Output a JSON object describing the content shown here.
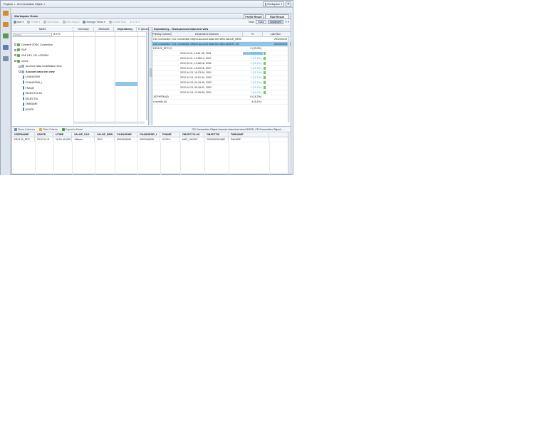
{
  "breadcrumb": {
    "root": "Projects",
    "item": "CD Connection Object"
  },
  "workspace_btn": "Workspace",
  "workspace": {
    "title": "Workspace Home",
    "profile_result": "Profile Result",
    "rule_result": "Rule Result"
  },
  "toolbar": {
    "add": "Add",
    "profile": "Profile",
    "view_data": "View Data",
    "view_import": "View Import",
    "manage_views": "Manage Views",
    "create_rule": "Create Rule",
    "view_label": "View:",
    "basic": "Basic",
    "advanced": "Advanced"
  },
  "left_panel": {
    "headers": {
      "tables": "Tables",
      "summary": "Summary",
      "attributes": "Attributes",
      "dependency": "Dependency",
      "r": "R",
      "advanced": "Advanc"
    },
    "search_placeholder": "Search",
    "tree": [
      {
        "label": "Overseft ODBC Connection",
        "indent": 0
      },
      {
        "label": "SAP",
        "indent": 0
      },
      {
        "label": "SAP DE1 120 LASDEM",
        "indent": 0
      },
      {
        "label": "Views",
        "indent": 0
      },
      {
        "label": "Account class modification view",
        "indent": 1
      },
      {
        "label": "Account class text view",
        "indent": 1,
        "bold": true
      },
      {
        "label": "CHANGENR",
        "indent": 2
      },
      {
        "label": "CHANGENR_L",
        "indent": 2
      },
      {
        "label": "FNAME",
        "indent": 2
      },
      {
        "label": "OBJECTCLAS",
        "indent": 2
      },
      {
        "label": "OBJECTID",
        "indent": 2
      },
      {
        "label": "TABNAME",
        "indent": 2
      },
      {
        "label": "UDATE",
        "indent": 2
      }
    ]
  },
  "right_panel": {
    "title": "Dependency - Views.Account class text view",
    "headers": {
      "primary": "Primary Column",
      "dependent": "Dependent Columns",
      "percent": "%",
      "last_run": "Last Run"
    },
    "rows": [
      {
        "c1": "CD Connection Object.Account",
        "c2": "CD Connection Object.Account class text view.VALUE_NEW",
        "c3": "",
        "c4": "2012/04/19",
        "sel": false
      },
      {
        "c1": "CD Connection Object.Account",
        "c2": "CD Connection Object.Account class text view.UDATE, CD",
        "c3": "",
        "c4": "2012/04/19",
        "sel": true
      },
      {
        "c1": "DE1120_RFC (9)",
        "c2": "",
        "c3": "9 (33.3%)",
        "c4": "",
        "sel": false
      },
      {
        "c1": "",
        "c2": "2012.04.11, 18:51:45, 2001",
        "c3": "1 (11.1%)",
        "c4": "",
        "sel": false,
        "hl": true
      },
      {
        "c1": "",
        "c2": "2012.04.11, 10:58:14, 2007",
        "c3": "1 (11.1%)",
        "c4": "",
        "sel": false
      },
      {
        "c1": "",
        "c2": "2012.04.11, 10:58:18, 2002",
        "c3": "1 (11.1%)",
        "c4": "",
        "sel": false
      },
      {
        "c1": "",
        "c2": "2012.04.11, 18:04:26, 2007",
        "c3": "1 (11.1%)",
        "c4": "",
        "sel": false
      },
      {
        "c1": "",
        "c2": "2012.04.13, 10:23:34, 2001",
        "c3": "1 (11.1%)",
        "c4": "",
        "sel": false
      },
      {
        "c1": "",
        "c2": "2012.04.13, 10:51:34, 2002",
        "c3": "1 (11.1%)",
        "c4": "",
        "sel": false
      },
      {
        "c1": "",
        "c2": "2012.04.13, 04:15:06, 2002",
        "c3": "1 (11.1%)",
        "c4": "",
        "sel": false
      },
      {
        "c1": "",
        "c2": "2012.04.13, 05:18:42, 2002",
        "c3": "1 (11.1%)",
        "c4": "",
        "sel": false
      },
      {
        "c1": "",
        "c2": "2012.04.13, 12:59:59, 2001",
        "c3": "1 (11.1%)",
        "c4": "",
        "sel": false
      },
      {
        "c1": "JATHERN (6)",
        "c2": "",
        "c3": "6 (18.2%)",
        "c4": "",
        "sel": false
      },
      {
        "c1": "n.mobile (4)",
        "c2": "",
        "c3": "4 (6.1%)",
        "c4": "",
        "sel": false
      }
    ]
  },
  "bottom": {
    "show_columns": "Show Columns",
    "filter_criteria": "Filter Criteria",
    "export": "Export to Excel",
    "path": "CD Connection Object.Account class text view.UDATE, CD Connection Object....",
    "columns": [
      "USERNAME",
      "UDATE",
      "UTIME",
      "VALUE_OLD",
      "VALUE_NEW",
      "CHANGENR",
      "CHANGENR_L",
      "FNAME",
      "OBJECTCLAS",
      "OBJECTID",
      "TABNAME"
    ],
    "row": [
      "DE1120_RFC",
      "2012.04.11",
      "18:51:45.000",
      "<Blank>",
      "2001",
      "0000348006",
      "0000348006",
      "KTOKL",
      "MAT_SKONT",
      "2200000001882",
      "PAKNRF"
    ]
  },
  "colors": {
    "accent": "#8fc6e8",
    "border": "#a9b6c6",
    "bar": "#79c36a"
  }
}
